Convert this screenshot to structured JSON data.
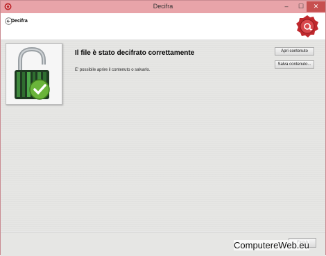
{
  "window": {
    "title": "Decifra"
  },
  "header": {
    "label": "Decifra"
  },
  "main": {
    "heading": "Il file è stato decifrato correttamente",
    "message": "E' possibile aprire il contenuto o salvarlo.",
    "open_label": "Apri contenuto",
    "save_label": "Salva contenuto..."
  },
  "footer": {
    "finish_label": "Finish"
  },
  "watermark": "ComputereWeb.eu",
  "colors": {
    "titlebar": "#e8a4a9",
    "close": "#c75050",
    "seal": "#c0282d"
  }
}
